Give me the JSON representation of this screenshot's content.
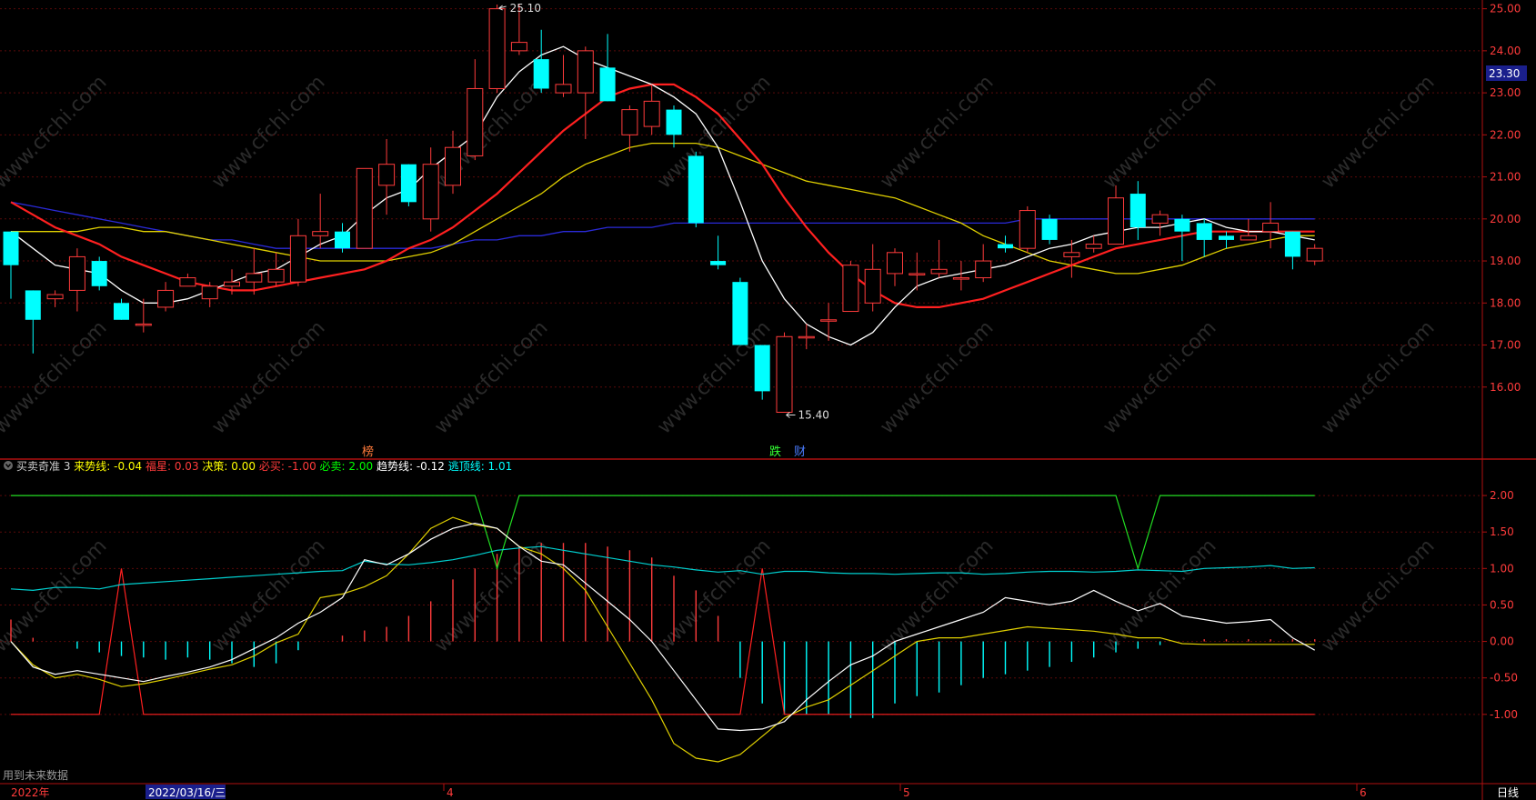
{
  "colors": {
    "up": "#ff3b3b",
    "down": "#00ffff",
    "ma5": "#ffffff",
    "ma10": "#ff2020",
    "ma20": "#e0d000",
    "ma60": "#2a2ad8",
    "frame": "#b01010"
  },
  "main_panel": {
    "ylim": [
      15.0,
      25.1
    ],
    "ticks": [
      "25.00",
      "24.00",
      "23.00",
      "22.00",
      "21.00",
      "20.00",
      "19.00",
      "18.00",
      "17.00",
      "16.00"
    ],
    "current_price": "23.30",
    "high_label": "25.10",
    "low_label": "15.40",
    "markers": {
      "bang": "榜",
      "die": "跌",
      "cai": "财"
    }
  },
  "indicator_panel": {
    "name": "买卖奇准 3",
    "items": [
      {
        "label": "来势线:",
        "value": "-0.04",
        "color": "#ffff00"
      },
      {
        "label": "福星:",
        "value": "0.03",
        "color": "#ff3b3b"
      },
      {
        "label": "决策:",
        "value": "0.00",
        "color": "#ffff00"
      },
      {
        "label": "必买:",
        "value": "-1.00",
        "color": "#ff3b3b"
      },
      {
        "label": "必卖:",
        "value": "2.00",
        "color": "#00ff00"
      },
      {
        "label": "趋势线:",
        "value": "-0.12",
        "color": "#ffffff"
      },
      {
        "label": "逃顶线:",
        "value": "1.01",
        "color": "#00ffff"
      }
    ],
    "ylim": [
      -1.7,
      2.25
    ],
    "ticks": [
      "2.00",
      "1.50",
      "1.00",
      "0.50",
      "0.00",
      "-0.50",
      "-1.00"
    ],
    "future_note": "用到未来数据"
  },
  "axis_bar": {
    "year_label": "2022年",
    "cursor_date": "2022/03/16/三",
    "months": [
      "4",
      "5",
      "6"
    ],
    "period_label": "日线"
  },
  "watermark": "www.cfchi.com",
  "chart_data": {
    "type": "candlestick",
    "candles": [
      [
        19.7,
        18.9,
        19.7,
        18.1
      ],
      [
        18.3,
        17.6,
        18.3,
        16.8
      ],
      [
        18.1,
        18.2,
        18.3,
        17.9
      ],
      [
        18.3,
        19.1,
        19.3,
        17.8
      ],
      [
        19.0,
        18.4,
        19.1,
        18.3
      ],
      [
        18.0,
        17.6,
        18.1,
        17.6
      ],
      [
        17.5,
        17.5,
        18.1,
        17.3
      ],
      [
        17.9,
        18.3,
        18.5,
        17.8
      ],
      [
        18.4,
        18.6,
        18.7,
        18.4
      ],
      [
        18.1,
        18.4,
        18.5,
        17.9
      ],
      [
        18.4,
        18.5,
        18.8,
        18.2
      ],
      [
        18.5,
        18.7,
        19.3,
        18.2
      ],
      [
        18.5,
        18.8,
        19.2,
        18.4
      ],
      [
        18.5,
        19.6,
        20.0,
        18.4
      ],
      [
        19.6,
        19.7,
        20.6,
        19.3
      ],
      [
        19.7,
        19.3,
        19.9,
        19.2
      ],
      [
        19.3,
        21.2,
        21.2,
        19.3
      ],
      [
        20.8,
        21.3,
        21.9,
        20.1
      ],
      [
        21.3,
        20.4,
        21.3,
        20.3
      ],
      [
        20.0,
        21.3,
        21.7,
        19.7
      ],
      [
        20.8,
        21.7,
        22.1,
        20.6
      ],
      [
        21.5,
        23.1,
        23.8,
        21.4
      ],
      [
        23.1,
        25.0,
        25.1,
        23.0
      ],
      [
        24.0,
        24.2,
        25.1,
        23.9
      ],
      [
        23.8,
        23.1,
        24.5,
        23.0
      ],
      [
        23.0,
        23.2,
        23.9,
        22.9
      ],
      [
        23.0,
        24.0,
        24.1,
        21.9
      ],
      [
        23.6,
        22.8,
        24.4,
        22.8
      ],
      [
        22.0,
        22.6,
        22.7,
        21.6
      ],
      [
        22.2,
        22.8,
        23.2,
        22.0
      ],
      [
        22.6,
        22.0,
        22.7,
        21.7
      ],
      [
        21.5,
        19.9,
        21.6,
        19.8
      ],
      [
        19.0,
        18.9,
        19.6,
        18.8
      ],
      [
        18.5,
        17.0,
        18.6,
        17.0
      ],
      [
        17.0,
        15.9,
        17.0,
        15.7
      ],
      [
        15.4,
        17.2,
        17.3,
        15.4
      ],
      [
        17.2,
        17.2,
        17.5,
        16.9
      ],
      [
        17.6,
        17.6,
        18.0,
        17.1
      ],
      [
        17.8,
        18.9,
        19.0,
        17.8
      ],
      [
        18.0,
        18.8,
        19.4,
        17.8
      ],
      [
        18.7,
        19.2,
        19.3,
        18.4
      ],
      [
        18.7,
        18.7,
        19.2,
        18.3
      ],
      [
        18.7,
        18.8,
        19.5,
        18.6
      ],
      [
        18.6,
        18.6,
        19.0,
        18.3
      ],
      [
        18.6,
        19.0,
        19.4,
        18.5
      ],
      [
        19.4,
        19.3,
        19.6,
        19.2
      ],
      [
        19.3,
        20.2,
        20.3,
        19.2
      ],
      [
        20.0,
        19.5,
        20.1,
        19.4
      ],
      [
        19.1,
        19.2,
        19.5,
        18.6
      ],
      [
        19.3,
        19.4,
        19.6,
        19.2
      ],
      [
        19.4,
        20.5,
        20.8,
        19.4
      ],
      [
        20.6,
        19.8,
        20.9,
        19.5
      ],
      [
        19.9,
        20.1,
        20.2,
        19.6
      ],
      [
        20.0,
        19.7,
        20.1,
        19.0
      ],
      [
        19.9,
        19.5,
        20.0,
        19.1
      ],
      [
        19.6,
        19.5,
        19.7,
        19.3
      ],
      [
        19.5,
        19.6,
        20.0,
        19.5
      ],
      [
        19.7,
        19.9,
        20.4,
        19.3
      ],
      [
        19.7,
        19.1,
        19.7,
        18.8
      ],
      [
        19.0,
        19.3,
        19.4,
        18.9
      ]
    ],
    "ma5": [
      19.7,
      19.3,
      18.9,
      18.8,
      18.7,
      18.3,
      18.0,
      18.0,
      18.1,
      18.3,
      18.5,
      18.7,
      18.8,
      19.1,
      19.4,
      19.6,
      20.1,
      20.5,
      20.7,
      21.2,
      21.6,
      22.0,
      22.9,
      23.5,
      23.9,
      24.1,
      23.8,
      23.6,
      23.4,
      23.2,
      22.9,
      22.5,
      21.7,
      20.4,
      19.0,
      18.1,
      17.5,
      17.2,
      17.0,
      17.3,
      17.9,
      18.4,
      18.6,
      18.7,
      18.8,
      18.9,
      19.1,
      19.3,
      19.4,
      19.6,
      19.7,
      19.8,
      19.8,
      19.9,
      20.0,
      19.8,
      19.7,
      19.7,
      19.6,
      19.5
    ],
    "ma10": [
      20.4,
      20.1,
      19.8,
      19.6,
      19.4,
      19.1,
      18.9,
      18.7,
      18.5,
      18.4,
      18.3,
      18.3,
      18.4,
      18.5,
      18.6,
      18.7,
      18.8,
      19.0,
      19.3,
      19.5,
      19.8,
      20.2,
      20.6,
      21.1,
      21.6,
      22.1,
      22.5,
      22.9,
      23.1,
      23.2,
      23.2,
      22.9,
      22.5,
      21.9,
      21.3,
      20.5,
      19.8,
      19.2,
      18.7,
      18.3,
      18.0,
      17.9,
      17.9,
      18.0,
      18.1,
      18.3,
      18.5,
      18.7,
      18.9,
      19.1,
      19.3,
      19.4,
      19.5,
      19.6,
      19.7,
      19.7,
      19.7,
      19.7,
      19.7,
      19.7
    ],
    "ma20": [
      19.7,
      19.7,
      19.7,
      19.7,
      19.8,
      19.8,
      19.7,
      19.7,
      19.6,
      19.5,
      19.4,
      19.3,
      19.2,
      19.1,
      19.0,
      19.0,
      19.0,
      19.0,
      19.1,
      19.2,
      19.4,
      19.7,
      20.0,
      20.3,
      20.6,
      21.0,
      21.3,
      21.5,
      21.7,
      21.8,
      21.8,
      21.8,
      21.7,
      21.5,
      21.3,
      21.1,
      20.9,
      20.8,
      20.7,
      20.6,
      20.5,
      20.3,
      20.1,
      19.9,
      19.6,
      19.4,
      19.2,
      19.0,
      18.9,
      18.8,
      18.7,
      18.7,
      18.8,
      18.9,
      19.1,
      19.3,
      19.4,
      19.5,
      19.6,
      19.6
    ],
    "ma60": [
      20.4,
      20.3,
      20.2,
      20.1,
      20.0,
      19.9,
      19.8,
      19.7,
      19.6,
      19.5,
      19.5,
      19.4,
      19.3,
      19.3,
      19.3,
      19.3,
      19.3,
      19.3,
      19.3,
      19.3,
      19.4,
      19.5,
      19.5,
      19.6,
      19.6,
      19.7,
      19.7,
      19.8,
      19.8,
      19.8,
      19.9,
      19.9,
      19.9,
      19.9,
      19.9,
      19.9,
      19.9,
      19.9,
      19.9,
      19.9,
      19.9,
      19.9,
      19.9,
      19.9,
      19.9,
      19.9,
      20.0,
      20.0,
      20.0,
      20.0,
      20.0,
      20.0,
      20.0,
      20.0,
      20.0,
      20.0,
      20.0,
      20.0,
      20.0,
      20.0
    ],
    "ind_trend": [
      0.0,
      -0.35,
      -0.45,
      -0.4,
      -0.45,
      -0.5,
      -0.55,
      -0.48,
      -0.42,
      -0.35,
      -0.25,
      -0.1,
      0.05,
      0.25,
      0.4,
      0.6,
      1.12,
      1.05,
      1.2,
      1.4,
      1.55,
      1.62,
      1.55,
      1.3,
      1.1,
      1.05,
      0.8,
      0.55,
      0.3,
      0.0,
      -0.4,
      -0.8,
      -1.2,
      -1.22,
      -1.2,
      -1.1,
      -0.8,
      -0.55,
      -0.32,
      -0.2,
      0.0,
      0.1,
      0.2,
      0.3,
      0.4,
      0.6,
      0.55,
      0.5,
      0.55,
      0.7,
      0.55,
      0.42,
      0.52,
      0.35,
      0.3,
      0.25,
      0.27,
      0.3,
      0.05,
      -0.12
    ],
    "ind_comein": [
      0.0,
      -0.32,
      -0.5,
      -0.45,
      -0.52,
      -0.62,
      -0.58,
      -0.52,
      -0.45,
      -0.38,
      -0.32,
      -0.2,
      -0.02,
      0.1,
      0.6,
      0.65,
      0.75,
      0.9,
      1.2,
      1.55,
      1.7,
      1.6,
      1.55,
      1.3,
      1.2,
      1.0,
      0.7,
      0.2,
      -0.3,
      -0.8,
      -1.4,
      -1.6,
      -1.65,
      -1.55,
      -1.3,
      -1.05,
      -0.9,
      -0.8,
      -0.6,
      -0.4,
      -0.2,
      0.0,
      0.05,
      0.05,
      0.1,
      0.15,
      0.2,
      0.18,
      0.16,
      0.14,
      0.1,
      0.05,
      0.05,
      -0.03,
      -0.04,
      -0.04,
      -0.04,
      -0.04,
      -0.04,
      -0.04
    ],
    "ind_top": [
      0.72,
      0.7,
      0.74,
      0.74,
      0.72,
      0.78,
      0.8,
      0.82,
      0.84,
      0.86,
      0.88,
      0.9,
      0.92,
      0.94,
      0.96,
      0.97,
      1.1,
      1.06,
      1.05,
      1.08,
      1.12,
      1.18,
      1.25,
      1.28,
      1.3,
      1.25,
      1.2,
      1.15,
      1.1,
      1.05,
      1.02,
      0.98,
      0.95,
      0.97,
      0.92,
      0.96,
      0.96,
      0.94,
      0.93,
      0.93,
      0.92,
      0.93,
      0.94,
      0.94,
      0.92,
      0.93,
      0.95,
      0.96,
      0.96,
      0.95,
      0.96,
      0.98,
      0.97,
      0.96,
      1.0,
      1.01,
      1.02,
      1.04,
      1.0,
      1.01
    ],
    "ind_hist": [
      0.3,
      0.05,
      0.0,
      -0.1,
      -0.15,
      -0.2,
      -0.22,
      -0.25,
      -0.22,
      -0.25,
      -0.3,
      -0.35,
      -0.3,
      -0.12,
      0.0,
      0.08,
      0.15,
      0.2,
      0.35,
      0.55,
      0.85,
      1.0,
      1.2,
      1.3,
      1.35,
      1.35,
      1.35,
      1.3,
      1.25,
      1.15,
      0.9,
      0.7,
      0.35,
      -0.5,
      -0.85,
      -1.0,
      -1.0,
      -1.0,
      -1.05,
      -1.05,
      -0.85,
      -0.75,
      -0.7,
      -0.6,
      -0.5,
      -0.45,
      -0.4,
      -0.35,
      -0.28,
      -0.22,
      -0.15,
      -0.1,
      -0.05,
      0.0,
      0.03,
      0.03,
      0.03,
      0.03,
      0.03,
      0.03
    ],
    "ind_buy_spikes": [
      5,
      34
    ],
    "ind_sell_dips": [
      22,
      51
    ]
  }
}
